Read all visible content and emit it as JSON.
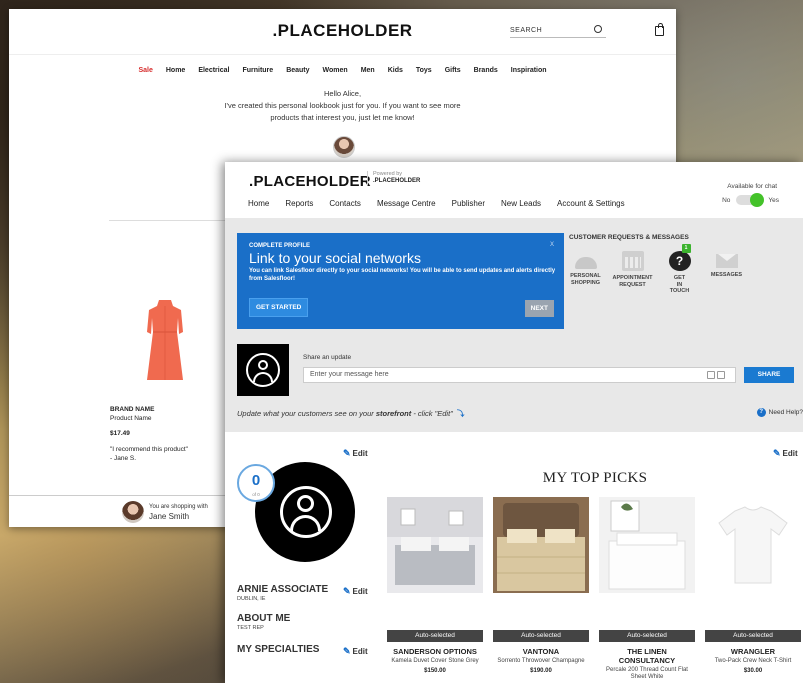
{
  "storefront": {
    "logo": ".PLACEHOLDER",
    "search_placeholder": "SEARCH",
    "nav": [
      "Sale",
      "Home",
      "Electrical",
      "Furniture",
      "Beauty",
      "Women",
      "Men",
      "Kids",
      "Toys",
      "Gifts",
      "Brands",
      "Inspiration"
    ],
    "greeting_line1": "Hello Alice,",
    "greeting_line2": "I've created this personal lookbook just for you. If you want to see more",
    "greeting_line3": "products that interest you, just let me know!",
    "product": {
      "brand": "BRAND NAME",
      "name": "Product Name",
      "price": "$17.49",
      "quote": "\"I recommend this product\"",
      "author": "- Jane S."
    },
    "shopping_with_label": "You are shopping with",
    "shopping_with_name": "Jane Smith"
  },
  "app": {
    "logo": ".PLACEHOLDER",
    "powered_by": "Powered by",
    "powered_name": ".PLACEHOLDER",
    "chat_label": "Available for chat",
    "chat_no": "No",
    "chat_yes": "Yes",
    "chat_available": true,
    "nav": [
      "Home",
      "Reports",
      "Contacts",
      "Message Centre",
      "Publisher",
      "New Leads",
      "Account & Settings"
    ],
    "profile_card": {
      "kicker": "COMPLETE PROFILE",
      "title": "Link to your social networks",
      "description": "You can link Salesfloor directly to your social networks! You will be able to send updates and alerts directly from Salesfloor!",
      "close": "X",
      "start_label": "GET STARTED",
      "next_label": "NEXT"
    },
    "customer_requests": {
      "title": "CUSTOMER REQUESTS & MESSAGES",
      "items": [
        {
          "label_1": "PERSONAL",
          "label_2": "SHOPPING",
          "label_3": "",
          "icon": "bell-icon"
        },
        {
          "label_1": "APPOINTMENT",
          "label_2": "REQUEST",
          "label_3": "",
          "icon": "calendar-icon"
        },
        {
          "label_1": "GET",
          "label_2": "IN",
          "label_3": "TOUCH",
          "icon": "question-icon",
          "badge": "1"
        },
        {
          "label_1": "MESSAGES",
          "label_2": "",
          "label_3": "",
          "icon": "envelope-icon"
        }
      ]
    },
    "share": {
      "label": "Share an update",
      "placeholder": "Enter your message here",
      "button": "SHARE"
    },
    "storefront_note_pre": "Update what your customers see on your ",
    "storefront_note_link": "storefront",
    "storefront_note_post": " - click \"Edit\"",
    "help_label": "Need Help?",
    "edit_label": "Edit",
    "count": "0",
    "count_of": "of 0",
    "associate_name": "ARNIE ASSOCIATE",
    "associate_location": "DUBLIN, IE",
    "about_title": "ABOUT ME",
    "about_text": "TEST REP",
    "specialties_title": "MY SPECIALTIES",
    "top_picks_title": "MY TOP PICKS",
    "picks": [
      {
        "tag": "Auto-selected",
        "brand": "SANDERSON OPTIONS",
        "desc": "Kamela Duvet Cover Stone Grey",
        "price": "$150.00"
      },
      {
        "tag": "Auto-selected",
        "brand": "VANTONA",
        "desc": "Sorrento Throwover Champagne",
        "price": "$190.00"
      },
      {
        "tag": "Auto-selected",
        "brand": "THE LINEN CONSULTANCY",
        "desc": "Percale 200 Thread Count Flat Sheet White",
        "price": ""
      },
      {
        "tag": "Auto-selected",
        "brand": "WRANGLER",
        "desc": "Two-Pack Crew Neck T-Shirt",
        "price": "$30.00"
      }
    ]
  }
}
